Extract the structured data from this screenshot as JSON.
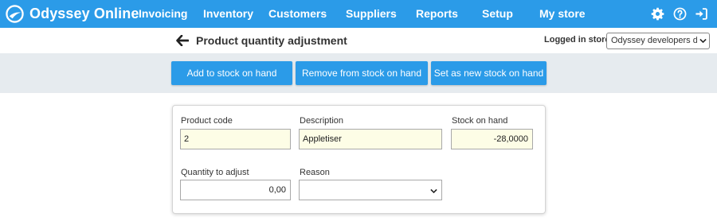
{
  "app": {
    "name": "Odyssey Online"
  },
  "nav": {
    "items": [
      {
        "label": "Invoicing"
      },
      {
        "label": "Inventory"
      },
      {
        "label": "Customers"
      },
      {
        "label": "Suppliers"
      },
      {
        "label": "Reports"
      },
      {
        "label": "Setup"
      },
      {
        "label": "My store"
      }
    ],
    "icons": [
      "gear-icon",
      "help-icon",
      "sign-in-icon"
    ]
  },
  "page": {
    "title": "Product quantity adjustment",
    "logged_in_label": "Logged in store",
    "store_selected": "Odyssey developers demo"
  },
  "actions": {
    "add_label": "Add to stock on hand",
    "remove_label": "Remove from stock on hand",
    "set_label": "Set as new stock on hand"
  },
  "form": {
    "product_code": {
      "label": "Product code",
      "value": "2"
    },
    "description": {
      "label": "Description",
      "value": "Appletiser"
    },
    "stock_on_hand": {
      "label": "Stock on hand",
      "value": "-28,0000"
    },
    "quantity_to_adjust": {
      "label": "Quantity to adjust",
      "value": "0,00"
    },
    "reason": {
      "label": "Reason",
      "value": ""
    }
  },
  "colors": {
    "primary": "#2b9be8",
    "band": "#e6ebef",
    "readonly_field": "#fdfde6"
  }
}
